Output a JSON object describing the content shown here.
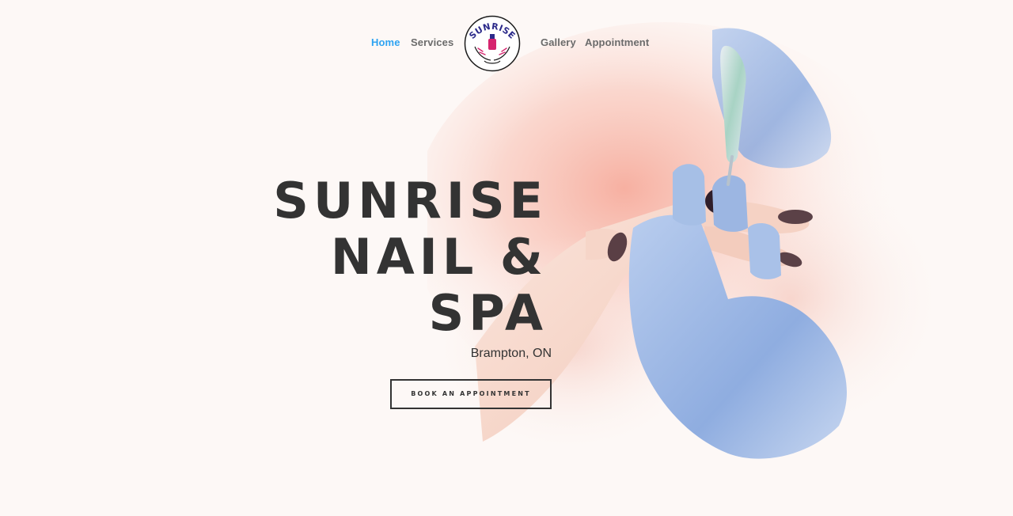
{
  "nav": {
    "items": [
      {
        "label": "Home",
        "active": true
      },
      {
        "label": "Services",
        "active": false
      },
      {
        "label": "Gallery",
        "active": false
      },
      {
        "label": "Appointment",
        "active": false
      }
    ],
    "logo": {
      "text": "SUNRISE",
      "icon": "nail-polish-hands-logo"
    }
  },
  "hero": {
    "title_lines": [
      "SUNRISE",
      "NAIL &",
      "SPA"
    ],
    "location": "Brampton, ON",
    "cta_label": "BOOK AN APPOINTMENT"
  },
  "colors": {
    "background": "#fdf8f6",
    "nav_active": "#2ea3f2",
    "nav_text": "#6b6b6b",
    "heading": "#333333",
    "glove": "#9db8e0",
    "watercolor": "#f7b7a8",
    "logo_text": "#2b2a8a",
    "logo_bottle": "#d6246e"
  }
}
